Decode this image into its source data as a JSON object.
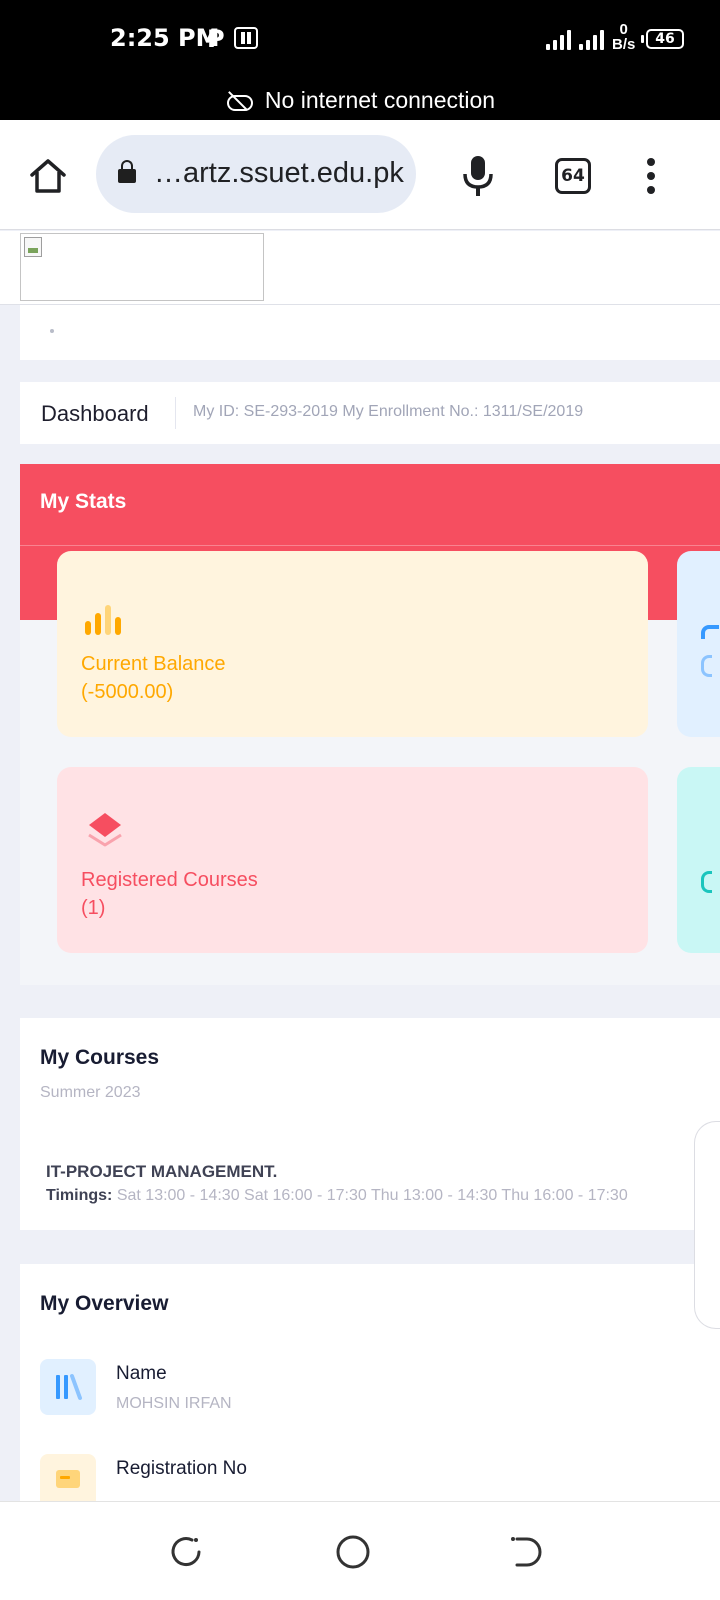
{
  "status_bar": {
    "time": "2:25 PM",
    "notification_p": "P",
    "net_speed_value": "0",
    "net_speed_unit": "B/s",
    "battery": "46"
  },
  "offline_banner": {
    "text": "No internet connection"
  },
  "browser": {
    "url": "…artz.ssuet.edu.pk",
    "tab_count": "64"
  },
  "breadcrumb": {
    "title": "Dashboard",
    "meta": "My ID: SE-293-2019 My Enrollment No.: 1311/SE/2019"
  },
  "stats": {
    "title": "My Stats",
    "header_color": "#f64e60",
    "cards": [
      {
        "label": "Current Balance",
        "value": "(-5000.00)",
        "icon": "bar-chart-icon",
        "color": "#ffa800",
        "bg": "#fff4de"
      },
      {
        "label": "Registered Courses",
        "value": "(1)",
        "icon": "layers-icon",
        "color": "#f64e60",
        "bg": "#ffe2e5"
      }
    ]
  },
  "courses": {
    "title": "My Courses",
    "term": "Summer 2023",
    "items": [
      {
        "name": "IT-PROJECT MANAGEMENT.",
        "timings_label": "Timings:",
        "timings": "Sat 13:00 - 14:30 Sat 16:00 - 17:30 Thu 13:00 - 14:30 Thu 16:00 - 17:30"
      }
    ]
  },
  "overview": {
    "title": "My Overview",
    "rows": [
      {
        "label": "Name",
        "value": "MOHSIN IRFAN",
        "icon": "library-icon"
      },
      {
        "label": "Registration No",
        "value": "",
        "icon": "id-card-icon"
      }
    ]
  }
}
